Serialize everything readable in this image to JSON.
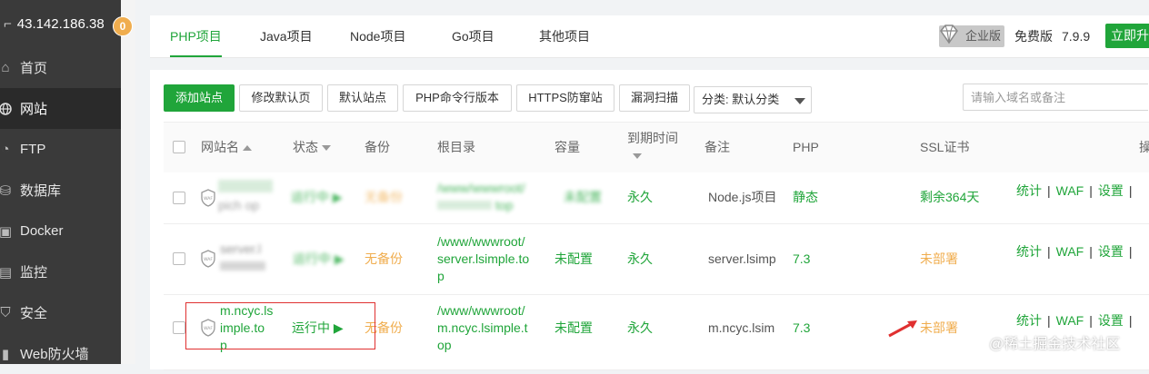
{
  "sidebar": {
    "server_ip": "43.142.186.38",
    "notification_count": "0",
    "items": [
      {
        "label": "首页",
        "icon": "home-icon"
      },
      {
        "label": "网站",
        "icon": "globe-icon",
        "active": true
      },
      {
        "label": "FTP",
        "icon": "ftp-icon"
      },
      {
        "label": "数据库",
        "icon": "database-icon"
      },
      {
        "label": "Docker",
        "icon": "docker-icon"
      },
      {
        "label": "监控",
        "icon": "monitor-icon"
      },
      {
        "label": "安全",
        "icon": "security-icon"
      },
      {
        "label": "Web防火墙",
        "icon": "firewall-icon"
      }
    ]
  },
  "tabs": [
    "PHP项目",
    "Java项目",
    "Node项目",
    "Go项目",
    "其他项目"
  ],
  "header": {
    "edition_badge": "企业版",
    "free_edition": "免费版",
    "version": "7.9.9",
    "upgrade_label": "立即升"
  },
  "toolbar": {
    "add_site": "添加站点",
    "edit_default_page": "修改默认页",
    "default_site": "默认站点",
    "php_cli_version": "PHP命令行版本",
    "https_protect": "HTTPS防窜站",
    "vuln_scan": "漏洞扫描",
    "category_select": "分类: 默认分类",
    "search_placeholder": "请输入域名或备注"
  },
  "table": {
    "headers": {
      "site_name": "网站名",
      "status": "状态",
      "backup": "备份",
      "root": "根目录",
      "capacity": "容量",
      "expiry": "到期时间",
      "note": "备注",
      "php": "PHP",
      "ssl": "SSL证书",
      "ops": "操"
    },
    "rows": [
      {
        "name": [
          "",
          "pich op"
        ],
        "status": "运行中",
        "backup": "无备份",
        "root": [
          "/www/wwwroot/",
          "top"
        ],
        "capacity": "未配置",
        "expiry": "永久",
        "note": "Node.js项目",
        "php": "静态",
        "ssl": "剩余364天",
        "ops": [
          "统计",
          "WAF",
          "设置"
        ]
      },
      {
        "name": [
          "server.l",
          ""
        ],
        "status": "运行中",
        "backup": "无备份",
        "root": [
          "/www/wwwroot/",
          "server.lsimple.to",
          "p"
        ],
        "capacity": "未配置",
        "expiry": "永久",
        "note": "server.lsimp",
        "php": "7.3",
        "ssl": "未部署",
        "ops": [
          "统计",
          "WAF",
          "设置"
        ]
      },
      {
        "name": [
          "m.ncyc.ls",
          "imple.to",
          "p"
        ],
        "status": "运行中",
        "backup": "无备份",
        "root": [
          "/www/wwwroot/",
          "m.ncyc.lsimple.t",
          "op"
        ],
        "capacity": "未配置",
        "expiry": "永久",
        "note": "m.ncyc.lsim",
        "php": "7.3",
        "ssl": "未部署",
        "ops": [
          "统计",
          "WAF",
          "设置"
        ]
      }
    ]
  },
  "watermark": "@稀土掘金技术社区",
  "colors": {
    "accent": "#20a53a",
    "warning": "#f0ad4e",
    "sidebar_bg": "#3a3a3a",
    "highlight_box": "#e03030"
  }
}
